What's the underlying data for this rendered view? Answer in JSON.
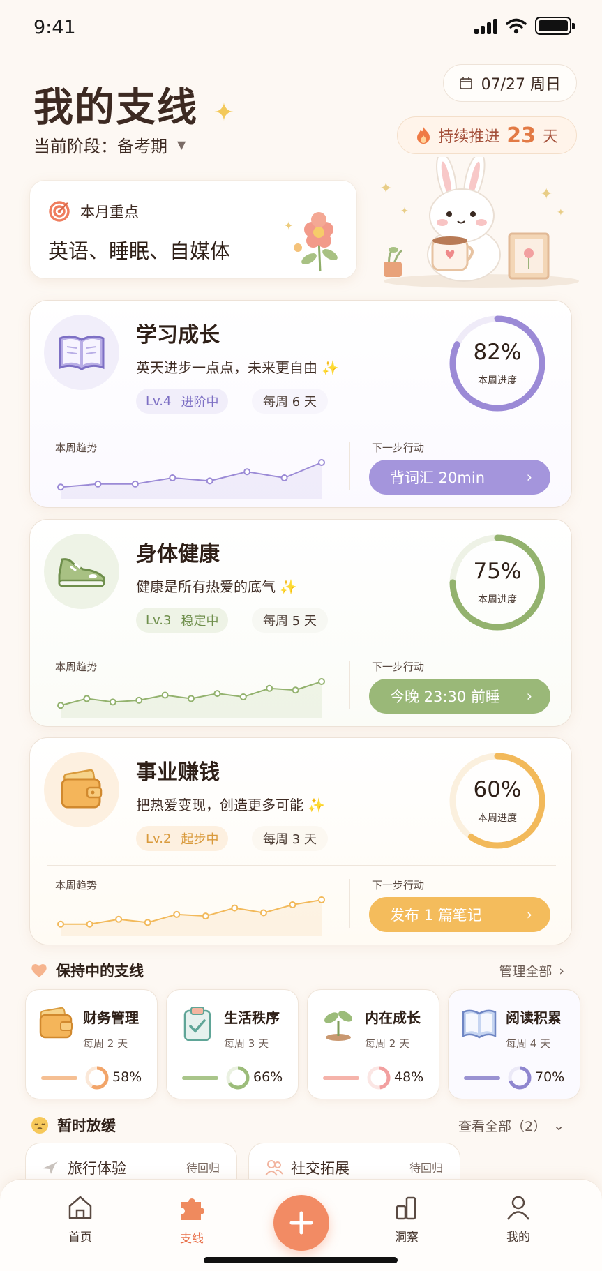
{
  "status_bar": {
    "time": "9:41"
  },
  "header": {
    "title": "我的支线",
    "stage_label": "当前阶段：",
    "stage_value": "备考期",
    "date": "07/27 周日",
    "streak_prefix": "持续推进",
    "streak_days": "23",
    "streak_suffix": "天"
  },
  "focus": {
    "label": "本月重点",
    "value": "英语、睡眠、自媒体"
  },
  "branches": [
    {
      "title": "学习成长",
      "subtitle": "英天进步一点点，未来更自由",
      "level": "Lv.4",
      "level_status": "进阶中",
      "frequency": "每周 6 天",
      "progress_pct": "82%",
      "progress": 0.82,
      "progress_label": "本周进度",
      "trend_label": "本周趋势",
      "trend": [
        2,
        3,
        3,
        5,
        4,
        7,
        5,
        10
      ],
      "next_label": "下一步行动",
      "next_action": "背词汇 20min",
      "color": "#9b8ad6",
      "icon": "book-icon"
    },
    {
      "title": "身体健康",
      "subtitle": "健康是所有热爱的底气",
      "level": "Lv.3",
      "level_status": "稳定中",
      "frequency": "每周 5 天",
      "progress_pct": "75%",
      "progress": 0.75,
      "progress_label": "本周进度",
      "trend_label": "本周趋势",
      "trend": [
        2,
        4,
        3,
        3.5,
        5,
        4,
        5.5,
        4.5,
        7,
        6.5,
        9
      ],
      "next_label": "下一步行动",
      "next_action": "今晚 23:30 前睡",
      "color": "#93b26e",
      "icon": "sneaker-icon"
    },
    {
      "title": "事业赚钱",
      "subtitle": "把热爱变现，创造更多可能",
      "level": "Lv.2",
      "level_status": "起步中",
      "frequency": "每周 3 天",
      "progress_pct": "60%",
      "progress": 0.6,
      "progress_label": "本周进度",
      "trend_label": "本周趋势",
      "trend": [
        2,
        2,
        3.5,
        2.5,
        5,
        4.5,
        7,
        5.5,
        8,
        9.5
      ],
      "next_label": "下一步行动",
      "next_action": "发布 1 篇笔记",
      "color": "#f2b95a",
      "icon": "wallet-icon"
    }
  ],
  "maintaining": {
    "title": "保持中的支线",
    "link": "管理全部",
    "items": [
      {
        "name": "财务管理",
        "frequency": "每周 2 天",
        "pct": "58%",
        "progress": 0.58,
        "color": "#f2a56a",
        "icon": "wallet-icon"
      },
      {
        "name": "生活秩序",
        "frequency": "每周 3 天",
        "pct": "66%",
        "progress": 0.66,
        "color": "#9cbc7a",
        "icon": "clipboard-check-icon"
      },
      {
        "name": "内在成长",
        "frequency": "每周 2 天",
        "pct": "48%",
        "progress": 0.48,
        "color": "#f2a0a0",
        "icon": "sprout-icon"
      },
      {
        "name": "阅读积累",
        "frequency": "每周 4 天",
        "pct": "70%",
        "progress": 0.7,
        "color": "#8f86cf",
        "icon": "open-book-icon"
      }
    ]
  },
  "paused": {
    "title": "暂时放缓",
    "link": "查看全部（2）",
    "items": [
      {
        "name": "旅行体验",
        "status": "待回归",
        "icon": "plane-icon"
      },
      {
        "name": "社交拓展",
        "status": "待回归",
        "icon": "people-icon"
      }
    ]
  },
  "tabs": [
    {
      "label": "首页",
      "icon": "home-icon"
    },
    {
      "label": "支线",
      "icon": "puzzle-icon"
    },
    {
      "label": "洞察",
      "icon": "bar-chart-icon"
    },
    {
      "label": "我的",
      "icon": "user-icon"
    }
  ]
}
